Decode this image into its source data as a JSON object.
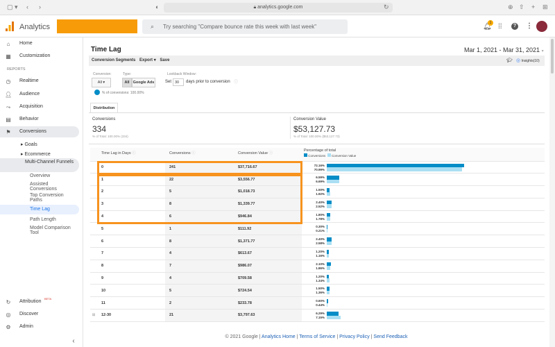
{
  "browser": {
    "url": "analytics.google.com"
  },
  "header": {
    "app_name": "Analytics",
    "search_placeholder": "Try searching \"Compare bounce rate this week with last week\"",
    "notification_count": "1"
  },
  "sidebar": {
    "home": "Home",
    "customization": "Customization",
    "reports_heading": "REPORTS",
    "realtime": "Realtime",
    "audience": "Audience",
    "acquisition": "Acquisition",
    "behavior": "Behavior",
    "conversions": "Conversions",
    "goals": "Goals",
    "ecommerce": "Ecommerce",
    "mcf": "Multi-Channel Funnels",
    "overview": "Overview",
    "assisted": "Assisted Conversions",
    "top_paths": "Top Conversion Paths",
    "time_lag": "Time Lag",
    "path_length": "Path Length",
    "model_comparison": "Model Comparison Tool",
    "attribution": "Attribution",
    "beta": "BETA",
    "discover": "Discover",
    "admin": "Admin"
  },
  "page": {
    "title": "Time Lag",
    "date_range": "Mar 1, 2021 - Mar 31, 2021",
    "insights": "Insights(10)"
  },
  "toolbar": {
    "segments": "Conversion Segments",
    "export": "Export ▾",
    "save": "Save"
  },
  "filters": {
    "conversion_label": "Conversion:",
    "conversion_value": "All ▾",
    "type_label": "Type:",
    "type_all": "All",
    "type_google_ads": "Google Ads",
    "lookback_label": "Lookback Window:",
    "set": "Set",
    "days_value": "30",
    "days_suffix": "days prior to conversion",
    "segment_pct": "% of conversions: 100.00%"
  },
  "tabs": {
    "distribution": "Distribution"
  },
  "summary": {
    "conversions_label": "Conversions",
    "conversions_value": "334",
    "conversions_sub": "% of Total: 100.00% (334)",
    "value_label": "Conversion Value",
    "value_value": "$53,127.73",
    "value_sub": "% of Total: 100.00% ($53,127.73)"
  },
  "table": {
    "headers": [
      "Time Lag in Days",
      "Conversions",
      "Conversion Value",
      "Percentage of total"
    ],
    "legend": [
      "Conversions",
      "Conversion Value"
    ],
    "colors": {
      "conversions": "#058dc7",
      "value": "#aadff3",
      "highlight": "#f7931e"
    },
    "rows": [
      {
        "lag": "0",
        "conv": "241",
        "value": "$37,716.67",
        "pc": "72.16%",
        "pv": "70.99%",
        "c": 72.16,
        "v": 70.99
      },
      {
        "lag": "1",
        "conv": "22",
        "value": "$3,556.77",
        "pc": "6.59%",
        "pv": "6.69%",
        "c": 6.59,
        "v": 6.69
      },
      {
        "lag": "2",
        "conv": "5",
        "value": "$1,018.73",
        "pc": "1.50%",
        "pv": "1.92%",
        "c": 1.5,
        "v": 1.92
      },
      {
        "lag": "3",
        "conv": "8",
        "value": "$1,339.77",
        "pc": "2.40%",
        "pv": "2.52%",
        "c": 2.4,
        "v": 2.52
      },
      {
        "lag": "4",
        "conv": "6",
        "value": "$946.84",
        "pc": "1.80%",
        "pv": "1.78%",
        "c": 1.8,
        "v": 1.78
      },
      {
        "lag": "5",
        "conv": "1",
        "value": "$111.92",
        "pc": "0.30%",
        "pv": "0.21%",
        "c": 0.3,
        "v": 0.21
      },
      {
        "lag": "6",
        "conv": "8",
        "value": "$1,371.77",
        "pc": "2.40%",
        "pv": "2.58%",
        "c": 2.4,
        "v": 2.58
      },
      {
        "lag": "7",
        "conv": "4",
        "value": "$613.67",
        "pc": "1.20%",
        "pv": "1.16%",
        "c": 1.2,
        "v": 1.16
      },
      {
        "lag": "8",
        "conv": "7",
        "value": "$986.07",
        "pc": "2.10%",
        "pv": "1.86%",
        "c": 2.1,
        "v": 1.86
      },
      {
        "lag": "9",
        "conv": "4",
        "value": "$709.58",
        "pc": "1.20%",
        "pv": "1.34%",
        "c": 1.2,
        "v": 1.34
      },
      {
        "lag": "10",
        "conv": "5",
        "value": "$724.54",
        "pc": "1.50%",
        "pv": "1.36%",
        "c": 1.5,
        "v": 1.36
      },
      {
        "lag": "11",
        "conv": "2",
        "value": "$233.78",
        "pc": "0.60%",
        "pv": "0.44%",
        "c": 0.6,
        "v": 0.44
      },
      {
        "lag": "12-30",
        "conv": "21",
        "value": "$3,797.63",
        "pc": "6.29%",
        "pv": "7.15%",
        "c": 6.29,
        "v": 7.15
      }
    ]
  },
  "footer": {
    "copyright": "© 2021 Google |",
    "home": "Analytics Home",
    "tos": "Terms of Service",
    "privacy": "Privacy Policy",
    "feedback": "Send Feedback"
  }
}
